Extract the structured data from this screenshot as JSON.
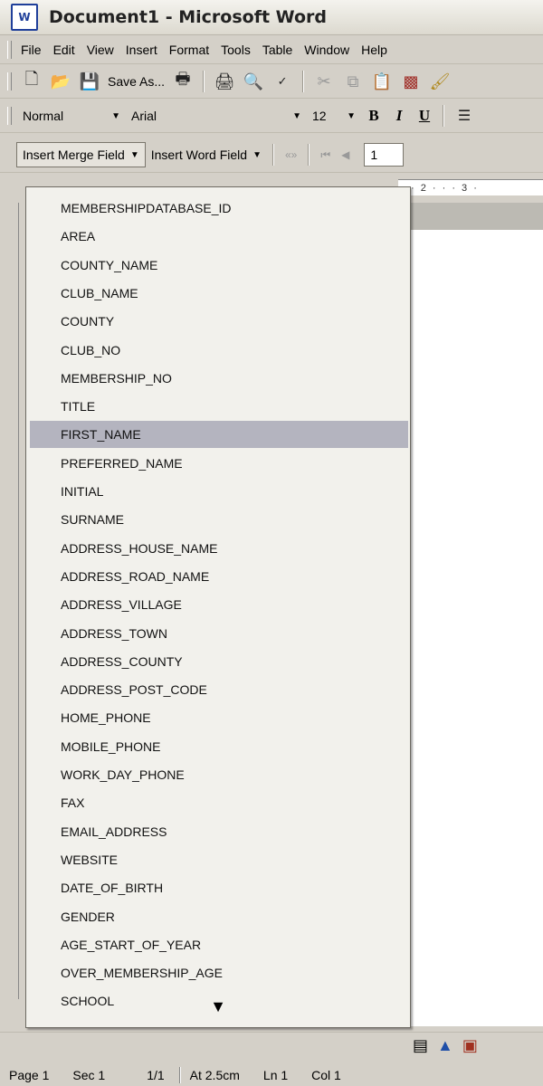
{
  "window": {
    "title": "Document1 - Microsoft Word",
    "app_icon": "W"
  },
  "menu": [
    "File",
    "Edit",
    "View",
    "Insert",
    "Format",
    "Tools",
    "Table",
    "Window",
    "Help"
  ],
  "standard_toolbar": {
    "save_as_label": "Save As..."
  },
  "formatting_toolbar": {
    "style": "Normal",
    "font": "Arial",
    "size": "12",
    "bold": "B",
    "italic": "I",
    "underline": "U"
  },
  "mail_merge_toolbar": {
    "insert_merge_field": "Insert Merge Field",
    "insert_word_field": "Insert Word Field",
    "merge_field_codes": "«»",
    "record_number": "1"
  },
  "ruler": {
    "text": "· 2 · · · 3 ·"
  },
  "merge_fields": [
    "MEMBERSHIPDATABASE_ID",
    "AREA",
    "COUNTY_NAME",
    "CLUB_NAME",
    "COUNTY",
    "CLUB_NO",
    "MEMBERSHIP_NO",
    "TITLE",
    "FIRST_NAME",
    "PREFERRED_NAME",
    "INITIAL",
    "SURNAME",
    "ADDRESS_HOUSE_NAME",
    "ADDRESS_ROAD_NAME",
    "ADDRESS_VILLAGE",
    "ADDRESS_TOWN",
    "ADDRESS_COUNTY",
    "ADDRESS_POST_CODE",
    "HOME_PHONE",
    "MOBILE_PHONE",
    "WORK_DAY_PHONE",
    "FAX",
    "EMAIL_ADDRESS",
    "WEBSITE",
    "DATE_OF_BIRTH",
    "GENDER",
    "AGE_START_OF_YEAR",
    "OVER_MEMBERSHIP_AGE",
    "SCHOOL"
  ],
  "highlighted_field": "FIRST_NAME",
  "status": {
    "page": "Page 1",
    "sec": "Sec 1",
    "pages": "1/1",
    "at": "At 2.5cm",
    "ln": "Ln 1",
    "col": "Col 1"
  },
  "colors": {
    "highlight": "#b4b4bf",
    "chrome": "#d4d0c8"
  }
}
